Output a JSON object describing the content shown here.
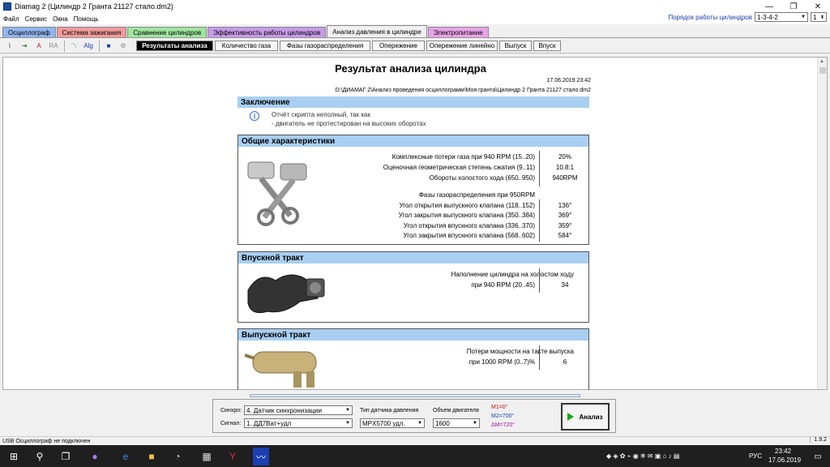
{
  "window": {
    "title": "Diamag 2 (Цилиндр 2 Гранта 21127 стало.dm2)",
    "min": "—",
    "max": "❐",
    "close": "✕"
  },
  "menu": [
    "Файл",
    "Сервис",
    "Окна",
    "Помощь"
  ],
  "firing_order": {
    "label": "Порядок работы цилиндров",
    "value": "1-3-4-2",
    "cyl": "1"
  },
  "module_tabs": [
    {
      "label": "Осциллограф",
      "color": "#8fb5ee"
    },
    {
      "label": "Система зажигания",
      "color": "#f29a9a"
    },
    {
      "label": "Сравнение цилиндров",
      "color": "#9fe59f"
    },
    {
      "label": "Эффективность работы цилиндров",
      "color": "#c79ae8"
    },
    {
      "label": "Анализ давления в цилиндре",
      "color": "#f0f0f0"
    },
    {
      "label": "Электропитание",
      "color": "#e8a3e8"
    }
  ],
  "sub_tabs": [
    "Результаты анализа",
    "Количество газа",
    "Фазы газораспределения",
    "Опережение",
    "Опережение линейно",
    "Выпуск",
    "Впуск"
  ],
  "toolbar_icons": [
    "signal-icon",
    "zoom-icon",
    "auto-icon",
    "ra-icon",
    "graph-icon",
    "alg-icon",
    "save-icon",
    "engine-icon"
  ],
  "report": {
    "title": "Результат анализа цилиндра",
    "date": "17.06.2019 23:42",
    "path": "D:\\ДИАМАГ 2\\Анализ проведения осциллограмм\\Моя гранта\\Цилиндр 2 Гранта 21127 стало.dm2",
    "conclusion": {
      "head": "Заключение",
      "line1": "Отчёт скрипта неполный, так как",
      "line2": "- двигатель не протестирован на высоких оборотах"
    },
    "general": {
      "head": "Общие характеристики",
      "rows": [
        {
          "label": "Комплексные потери газа при 940 RPM (15..20)",
          "value": "20%"
        },
        {
          "label": "Оценочная геометрическая степень сжатия (9..11)",
          "value": "10.8:1"
        },
        {
          "label": "Обороты холостого хода (650..950)",
          "value": "940RPM"
        }
      ],
      "phases_title": "Фазы газораспределения при 950RPM",
      "phases": [
        {
          "label": "Угол открытия выпускного клапана (118..152)",
          "value": "136°"
        },
        {
          "label": "Угол закрытия выпускного клапана (350..384)",
          "value": "369°"
        },
        {
          "label": "Угол открытия впускного клапана (336..370)",
          "value": "359°"
        },
        {
          "label": "Угол закрытия впускного клапана (568..602)",
          "value": "584°"
        }
      ]
    },
    "intake": {
      "head": "Впускной тракт",
      "line1": "Наполнение цилиндра на холостом ходу",
      "line2": "при 940 RPM (20..45)",
      "value": "34"
    },
    "exhaust": {
      "head": "Выпускной тракт",
      "line1": "Потери мощности на такте выпуска",
      "line2": "при  1000 RPM (0..7)%",
      "value": "6"
    }
  },
  "controls": {
    "sync_label": "Синхро:",
    "sync_value": "4.  Датчик синхронизации",
    "signal_label": "Сигнал:",
    "signal_value": "1.  ДД7Ват+удл",
    "sensor_label": "Тип датчика давления",
    "sensor_value": "MPX5700 удл.",
    "volume_label": "Объем двигателя",
    "volume_value": "1600",
    "m1": "M1=0°",
    "m2": "M2=700°",
    "dm": "ΔM=720°",
    "analyze": "Анализ"
  },
  "status": {
    "text": "USB Осциллограф не подключен",
    "version": "1.9.2"
  },
  "taskbar": {
    "lang": "РУС",
    "time": "23:42",
    "date": "17.06.2019"
  }
}
